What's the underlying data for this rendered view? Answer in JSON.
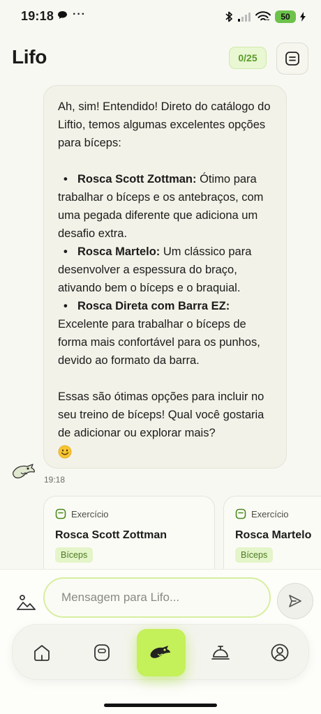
{
  "status_bar": {
    "time": "19:18",
    "dots": "···",
    "battery": "50"
  },
  "header": {
    "title": "Lifo",
    "counter": "0/25",
    "menu_icon": "list-icon"
  },
  "chat": {
    "message": {
      "intro": "Ah, sim! Entendido! Direto do catálogo do Liftio, temos algumas excelentes opções para bíceps:",
      "items": [
        {
          "name": "Rosca Scott Zottman:",
          "desc": " Ótimo para trabalhar o bíceps e os antebraços, com uma pegada diferente que adiciona um desafio extra."
        },
        {
          "name": "Rosca Martelo:",
          "desc": " Um clássico para desenvolver a espessura do braço, ativando bem o bíceps e o braquial."
        },
        {
          "name": "Rosca Direta com Barra EZ:",
          "desc": " Excelente para trabalhar o bíceps de forma mais confortável para os punhos, devido ao formato da barra."
        }
      ],
      "outro": "Essas são ótimas opções para incluir no seu treino de bíceps! Qual você gostaria de adicionar ou explorar mais?",
      "emoji": "smiling-face-icon",
      "time": "19:18"
    }
  },
  "cards": [
    {
      "type": "Exercício",
      "title": "Rosca Scott Zottman",
      "tag": "Bíceps"
    },
    {
      "type": "Exercício",
      "title": "Rosca Martelo",
      "tag": "Bíceps"
    }
  ],
  "composer": {
    "placeholder": "Mensagem para Lifo...",
    "attach_icon": "image-icon",
    "send_icon": "send-icon"
  },
  "nav": {
    "items": [
      "home-icon",
      "workout-icon",
      "ai-assistant-icon",
      "service-bell-icon",
      "profile-icon"
    ],
    "active": "ai-assistant-icon"
  },
  "colors": {
    "accent": "#c4f05a",
    "tag_bg": "#e4f5c9",
    "background": "#f8f8f3"
  }
}
